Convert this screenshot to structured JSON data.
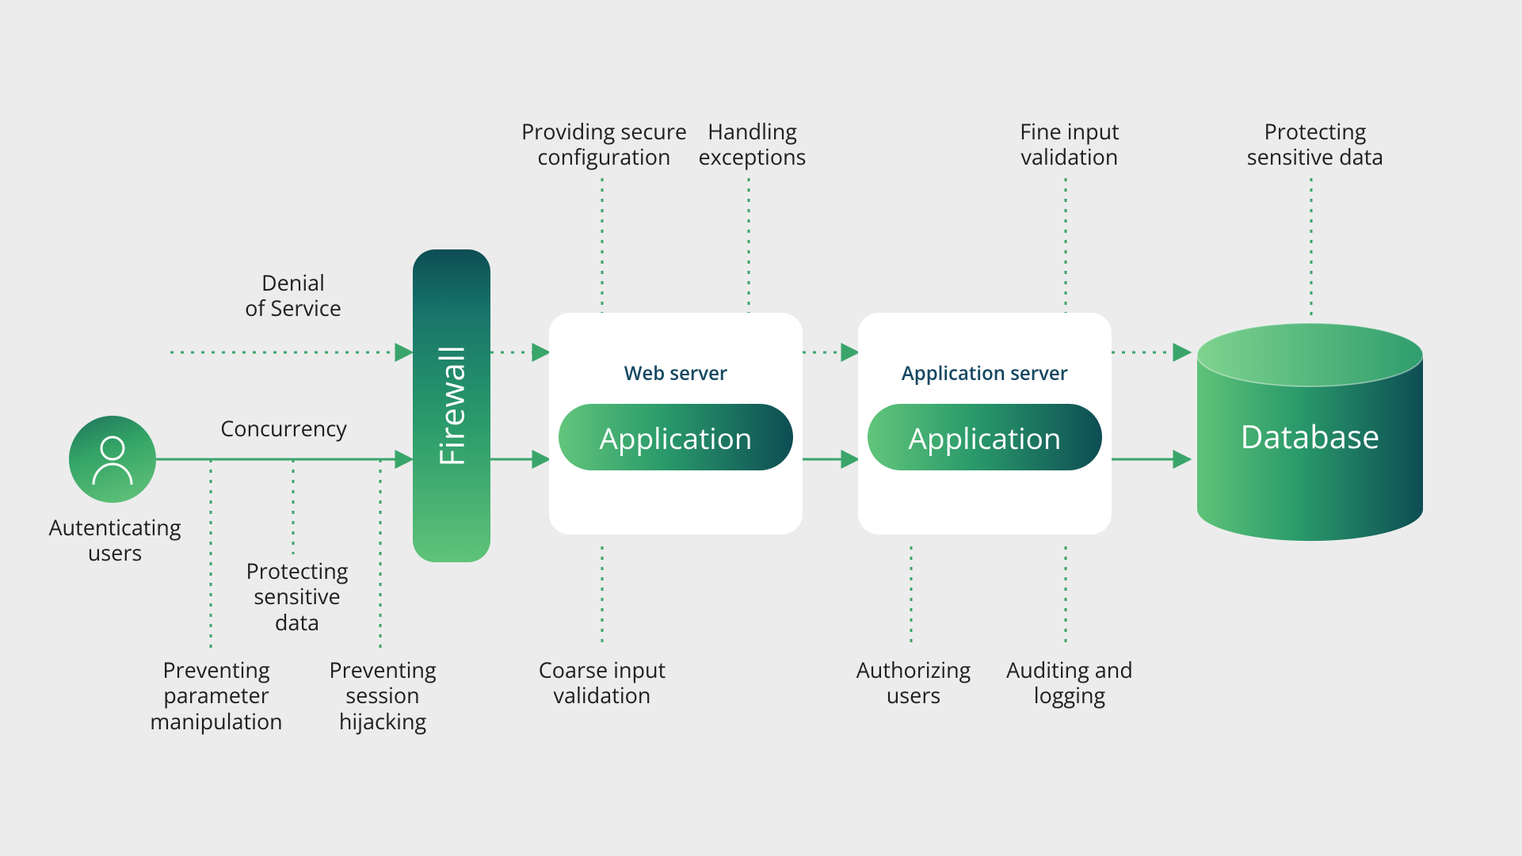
{
  "user": {
    "label": "Autenticating\nusers"
  },
  "firewall": {
    "label": "Firewall"
  },
  "web_server": {
    "title": "Web server",
    "app_label": "Application"
  },
  "app_server": {
    "title": "Application server",
    "app_label": "Application"
  },
  "database": {
    "label": "Database"
  },
  "annotations": {
    "denial_of_service": "Denial\nof Service",
    "concurrency": "Concurrency",
    "preventing_parameter_manipulation": "Preventing\nparameter\nmanipulation",
    "protecting_sensitive_data_left": "Protecting\nsensitive\ndata",
    "preventing_session_hijacking": "Preventing\nsession\nhijacking",
    "providing_secure_configuration": "Providing secure\nconfiguration",
    "coarse_input_validation": "Coarse input\nvalidation",
    "handling_exceptions": "Handling\nexceptions",
    "authorizing_users": "Authorizing\nusers",
    "auditing_and_logging": "Auditing and\nlogging",
    "fine_input_validation": "Fine input\nvalidation",
    "protecting_sensitive_data_right": "Protecting\nsensitive data"
  },
  "colors": {
    "bg": "#ececec",
    "text": "#1f1f1f",
    "green_solid": "#2a9a6a",
    "green_light": "#66c57b",
    "teal_dark": "#0d4d54",
    "navy_title": "#154761",
    "connector": "#3aa56a"
  }
}
